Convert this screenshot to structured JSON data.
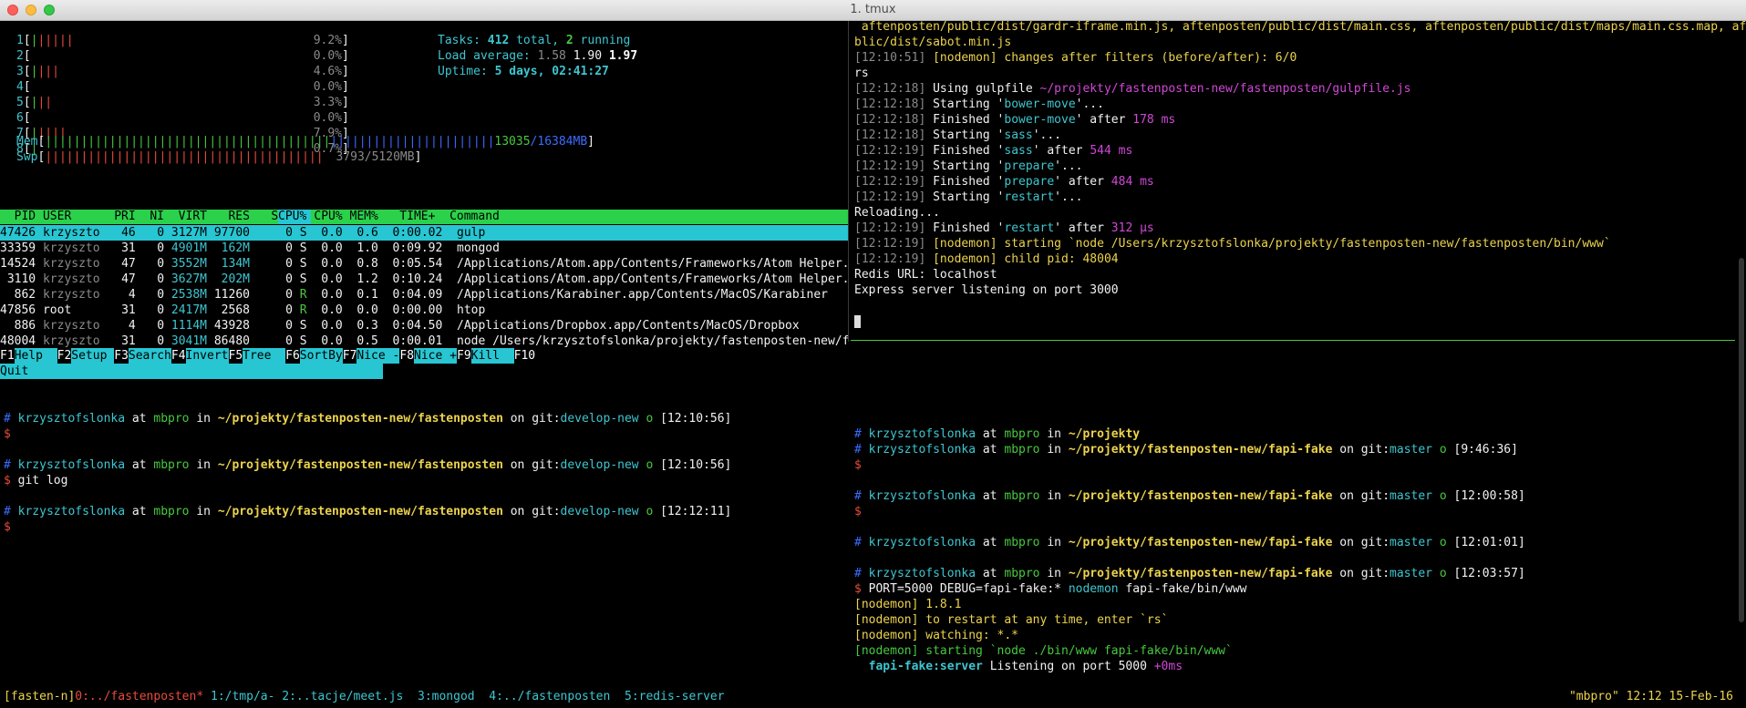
{
  "window": {
    "title": "1. tmux"
  },
  "htop": {
    "cpus": [
      {
        "num": "1",
        "bar": "||||||",
        "pct": "9.2%"
      },
      {
        "num": "2",
        "bar": "",
        "pct": "0.0%"
      },
      {
        "num": "3",
        "bar": "||||",
        "pct": "4.6%"
      },
      {
        "num": "4",
        "bar": "",
        "pct": "0.0%"
      },
      {
        "num": "5",
        "bar": "|||",
        "pct": "3.3%"
      },
      {
        "num": "6",
        "bar": "",
        "pct": "0.0%"
      },
      {
        "num": "7",
        "bar": "|||||",
        "pct": "7.9%"
      },
      {
        "num": "8",
        "bar": "|",
        "pct": "0.7%"
      }
    ],
    "mem": {
      "label": "Mem",
      "bar": "||||||||||||||||||||||||||||||||||||||||",
      "used": "13035",
      "total": "/16384MB"
    },
    "swp": {
      "label": "Swp",
      "bar": "|||||||||||||||||||||||||||||||||||||||",
      "value": "3793/5120MB"
    },
    "tasks": {
      "label": "Tasks: ",
      "total": "412",
      "total_suffix": " total, ",
      "running": "2",
      "running_suffix": " running"
    },
    "load": {
      "label": "Load average: ",
      "l1": "1.58",
      "l5": "1.90",
      "l15": "1.97"
    },
    "uptime": {
      "label": "Uptime: ",
      "value": "5 days, 02:41:27"
    },
    "header": "  PID USER      PRI  NI  VIRT   RES   SHR S CPU% MEM%   TIME+  Command",
    "processes": [
      {
        "pid": "47426",
        "user": "krzyszto",
        "pri": "46",
        "ni": "0",
        "virt": "3127M",
        "res": "97700",
        "shr": "0",
        "s": "S",
        "cpu": "0.0",
        "mem": "0.6",
        "time": "0:00.02",
        "cmd": "gulp"
      },
      {
        "pid": "33359",
        "user": "krzyszto",
        "pri": "31",
        "ni": "0",
        "virt": "4901M",
        "res": "162M",
        "shr": "0",
        "s": "S",
        "cpu": "0.0",
        "mem": "1.0",
        "time": "0:09.92",
        "cmd": "mongod"
      },
      {
        "pid": "14524",
        "user": "krzyszto",
        "pri": "47",
        "ni": "0",
        "virt": "3552M",
        "res": "134M",
        "shr": "0",
        "s": "S",
        "cpu": "0.0",
        "mem": "0.8",
        "time": "0:05.54",
        "cmd": "/Applications/Atom.app/Contents/Frameworks/Atom Helper.app/Contents/Ma"
      },
      {
        "pid": "3110",
        "user": "krzyszto",
        "pri": "47",
        "ni": "0",
        "virt": "3627M",
        "res": "202M",
        "shr": "0",
        "s": "S",
        "cpu": "0.0",
        "mem": "1.2",
        "time": "0:10.24",
        "cmd": "/Applications/Atom.app/Contents/Frameworks/Atom Helper.app/Contents/Ma"
      },
      {
        "pid": "862",
        "user": "krzyszto",
        "pri": "4",
        "ni": "0",
        "virt": "2538M",
        "res": "11260",
        "shr": "0",
        "s": "R",
        "cpu": "0.0",
        "mem": "0.1",
        "time": "0:04.09",
        "cmd": "/Applications/Karabiner.app/Contents/MacOS/Karabiner"
      },
      {
        "pid": "47856",
        "user": "root",
        "pri": "31",
        "ni": "0",
        "virt": "2417M",
        "res": "2568",
        "shr": "0",
        "s": "R",
        "cpu": "0.0",
        "mem": "0.0",
        "time": "0:00.00",
        "cmd": "htop"
      },
      {
        "pid": "886",
        "user": "krzyszto",
        "pri": "4",
        "ni": "0",
        "virt": "1114M",
        "res": "43928",
        "shr": "0",
        "s": "S",
        "cpu": "0.0",
        "mem": "0.3",
        "time": "0:04.50",
        "cmd": "/Applications/Dropbox.app/Contents/MacOS/Dropbox"
      },
      {
        "pid": "48004",
        "user": "krzyszto",
        "pri": "31",
        "ni": "0",
        "virt": "3041M",
        "res": "86480",
        "shr": "0",
        "s": "S",
        "cpu": "0.0",
        "mem": "0.5",
        "time": "0:00.01",
        "cmd": "node /Users/krzysztofslonka/projekty/fastenposten-new/fastenposten/bin"
      }
    ],
    "fkeys": [
      {
        "key": "F1",
        "label": "Help  "
      },
      {
        "key": "F2",
        "label": "Setup "
      },
      {
        "key": "F3",
        "label": "Search"
      },
      {
        "key": "F4",
        "label": "Invert"
      },
      {
        "key": "F5",
        "label": "Tree  "
      },
      {
        "key": "F6",
        "label": "SortBy"
      },
      {
        "key": "F7",
        "label": "Nice -"
      },
      {
        "key": "F8",
        "label": "Nice +"
      },
      {
        "key": "F9",
        "label": "Kill  "
      },
      {
        "key": "F10",
        "label": "Quit"
      }
    ]
  },
  "gulp_log": {
    "l1": " aftenposten/public/dist/gardr-iframe.min.js, aftenposten/public/dist/main.css, aftenposten/public/dist/maps/main.css.map, aftenposten/pu",
    "l2": "blic/dist/sabot.min.js",
    "l3_time": "[12:10:51]",
    "l3_text": " [nodemon] changes after filters (before/after): 6/0",
    "l4": "rs",
    "l5_time": "[12:12:18]",
    "l5_text": " Using gulpfile ",
    "l5_path": "~/projekty/fastenposten-new/fastenposten/gulpfile.js",
    "entries": [
      {
        "time": "[12:12:18]",
        "a": " Starting '",
        "task": "bower-move",
        "b": "'...",
        "dur": ""
      },
      {
        "time": "[12:12:18]",
        "a": " Finished '",
        "task": "bower-move",
        "b": "' after ",
        "dur": "178 ms"
      },
      {
        "time": "[12:12:18]",
        "a": " Starting '",
        "task": "sass",
        "b": "'...",
        "dur": ""
      },
      {
        "time": "[12:12:19]",
        "a": " Finished '",
        "task": "sass",
        "b": "' after ",
        "dur": "544 ms"
      },
      {
        "time": "[12:12:19]",
        "a": " Starting '",
        "task": "prepare",
        "b": "'...",
        "dur": ""
      },
      {
        "time": "[12:12:19]",
        "a": " Finished '",
        "task": "prepare",
        "b": "' after ",
        "dur": "484 ms"
      },
      {
        "time": "[12:12:19]",
        "a": " Starting '",
        "task": "restart",
        "b": "'...",
        "dur": ""
      }
    ],
    "reloading": "Reloading...",
    "fin_time": "[12:12:19]",
    "fin_a": " Finished '",
    "fin_task": "restart",
    "fin_b": "' after ",
    "fin_dur": "312 μs",
    "n1_time": "[12:12:19]",
    "n1_text": " [nodemon] starting `node /Users/krzysztofslonka/projekty/fastenposten-new/fastenposten/bin/www`",
    "n2_time": "[12:12:19]",
    "n2_text": " [nodemon] child pid: 48004",
    "redis": "Redis URL: localhost",
    "express": "Express server listening on port 3000"
  },
  "left_shell": {
    "user": "krzysztofslonka",
    "host": "mbpro",
    "path": "~/projekty/fastenposten-new/fastenposten",
    "branch": "develop-new",
    "t1": "[12:10:56]",
    "t2": "[12:10:56]",
    "t3": "[12:12:11]",
    "cmd": "git log"
  },
  "right_shell": {
    "user": "krzysztofslonka",
    "host": "mbpro",
    "p0": "~/projekty",
    "path": "~/projekty/fastenposten-new/fapi-fake",
    "branch": "master",
    "t1": "[9:46:36]",
    "t2": "[12:00:58]",
    "t3": "[12:01:01]",
    "t4": "[12:03:57]",
    "cmd_env": "PORT=5000 DEBUG=fapi-fake:* ",
    "cmd_bin": "nodemon",
    "cmd_arg": " fapi-fake/bin/www",
    "n1": "[nodemon] 1.8.1",
    "n2": "[nodemon] to restart at any time, enter `rs`",
    "n3": "[nodemon] watching: *.*",
    "n4": "[nodemon] starting `node ./bin/www fapi-fake/bin/www`",
    "srv_name": "fapi-fake:server",
    "srv_text": " Listening on port 5000 ",
    "srv_time": "+0ms"
  },
  "status": {
    "session": "[fasten-n]",
    "w0": "0:../fastenposten*",
    "w1": "1:/tmp/a-",
    "w2": "2:..tacje/meet.js",
    "w3": "3:mongod",
    "w4": "4:../fastenposten",
    "w5": "5:redis-server",
    "right": "\"mbpro\" 12:12 15-Feb-16"
  },
  "colors": {
    "cyan": "#3ec6d0",
    "green": "#47c93e",
    "yellow": "#ecd34d",
    "red": "#e74c3c",
    "magenta": "#d048d6"
  }
}
